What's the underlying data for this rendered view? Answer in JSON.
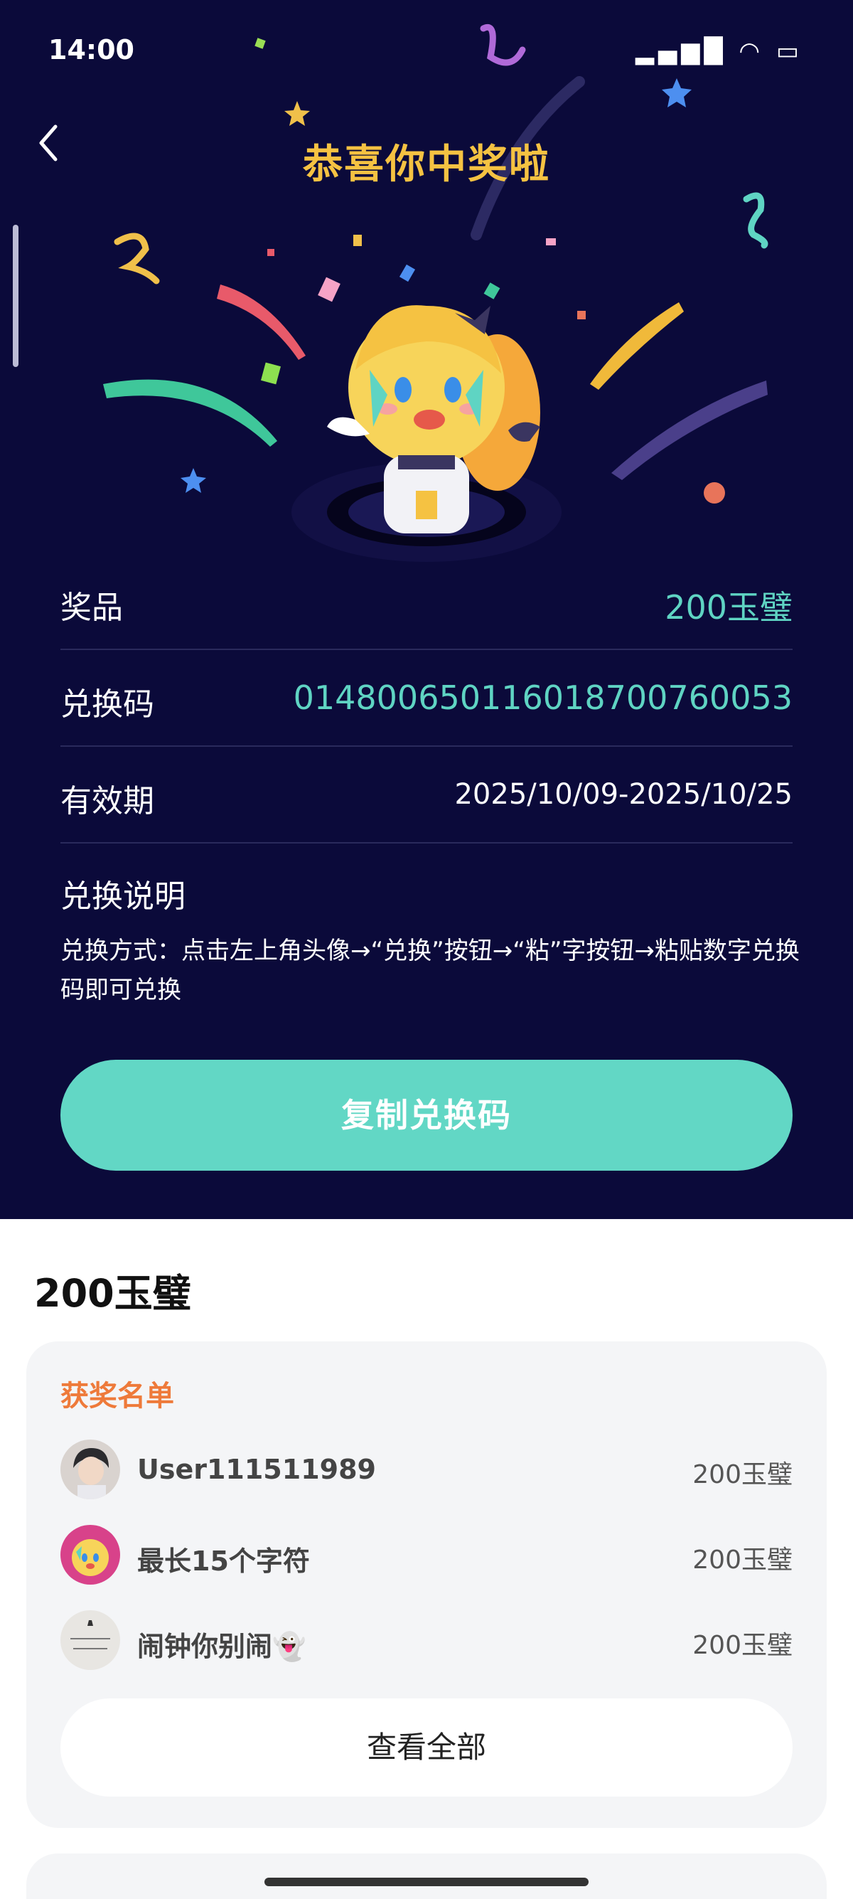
{
  "status_bar": {
    "time": "14:00"
  },
  "header": {
    "title": "恭喜你中奖啦"
  },
  "info": {
    "prize_label": "奖品",
    "prize_value": "200玉璧",
    "code_label": "兑换码",
    "code_value": "014800650116018700760053",
    "validity_label": "有效期",
    "validity_value": "2025/10/09-2025/10/25"
  },
  "instructions": {
    "title": "兑换说明",
    "text": "兑换方式：点击左上角头像→“兑换”按钮→“粘”字按钮→粘贴数字兑换码即可兑换"
  },
  "copy_button": {
    "label": "复制兑换码"
  },
  "prize_heading": "200玉璧",
  "winners": {
    "title": "获奖名单",
    "items": [
      {
        "name": "User111511989",
        "prize": "200玉璧"
      },
      {
        "name": "最长15个字符",
        "prize": "200玉璧"
      },
      {
        "name": "闹钟你别闹👻",
        "prize": "200玉璧"
      }
    ],
    "view_all_label": "查看全部"
  },
  "colors": {
    "hero_bg": "#0b0a3a",
    "title_gold": "#f5c242",
    "accent_teal": "#62d7c5",
    "winners_orange": "#ee7a3a"
  }
}
